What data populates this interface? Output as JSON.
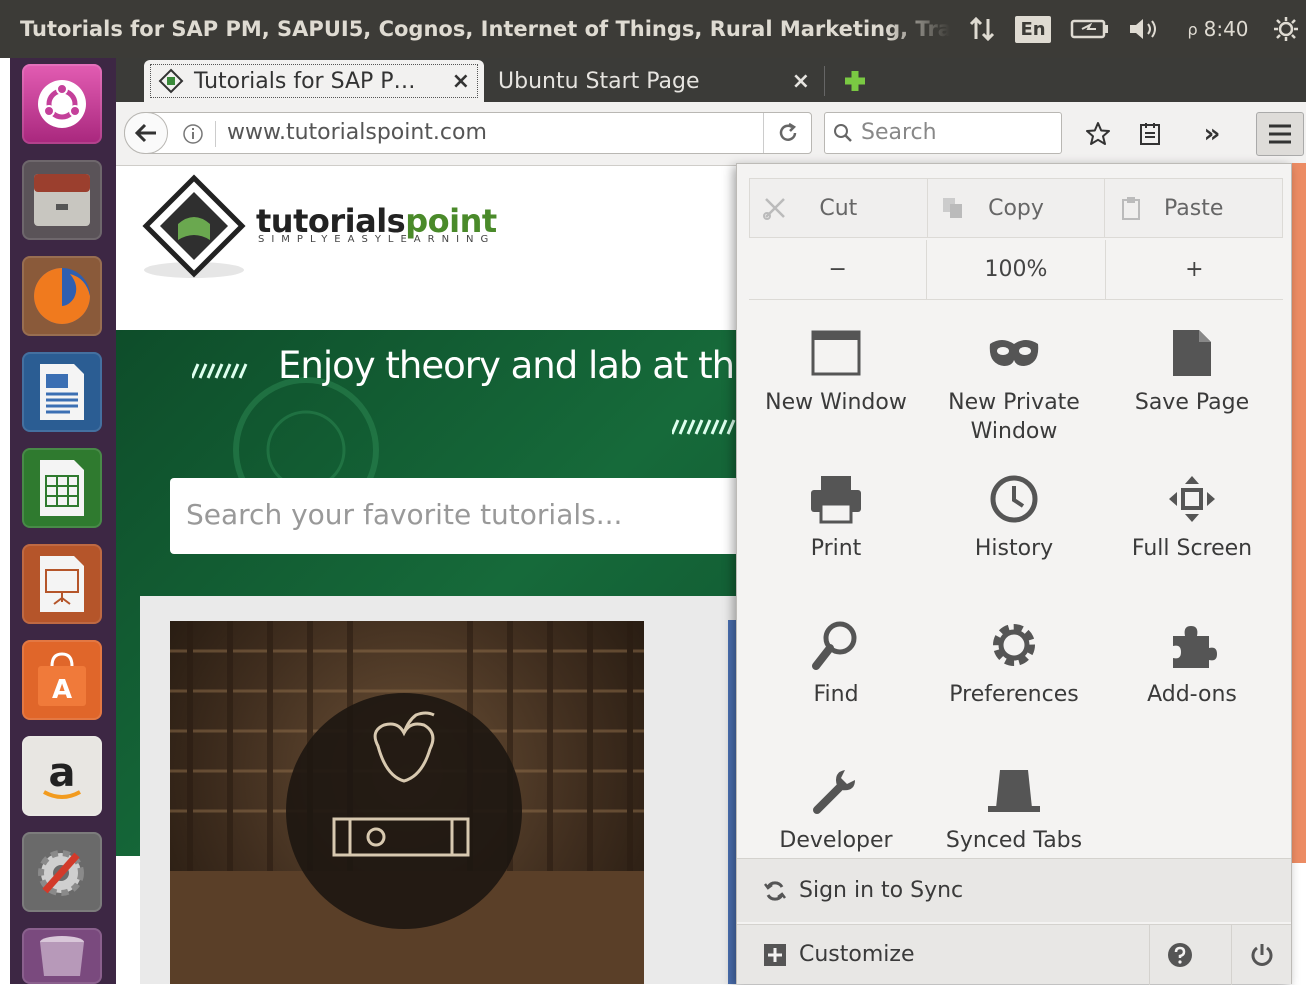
{
  "system_bar": {
    "window_title": "Tutorials for SAP PM, SAPUI5, Cognos, Internet of Things, Rural Marketing, Tra",
    "keyboard_layout": "En",
    "time": "8:40"
  },
  "tabs": [
    {
      "label": "Tutorials for SAP P…",
      "close": "×"
    },
    {
      "label": "Ubuntu Start Page",
      "close": "×"
    }
  ],
  "navbar": {
    "url": "www.tutorialspoint.com",
    "search_placeholder": "Search"
  },
  "page": {
    "logo_text_1": "tutorials",
    "logo_text_2": "point",
    "logo_tagline": "SIMPLYEASYLEARNING",
    "hero_text": "Enjoy theory and lab at the s",
    "search_placeholder": "Search your favorite tutorials..."
  },
  "menu": {
    "edit": {
      "cut": "Cut",
      "copy": "Copy",
      "paste": "Paste"
    },
    "zoom": {
      "minus": "−",
      "level": "100%",
      "plus": "+"
    },
    "items": [
      {
        "label": "New Window",
        "icon": "new-window-icon"
      },
      {
        "label": "New Private Window",
        "icon": "private-mask-icon"
      },
      {
        "label": "Save Page",
        "icon": "save-page-icon"
      },
      {
        "label": "Print",
        "icon": "printer-icon"
      },
      {
        "label": "History",
        "icon": "clock-icon"
      },
      {
        "label": "Full Screen",
        "icon": "full-screen-icon"
      },
      {
        "label": "Find",
        "icon": "magnifier-icon"
      },
      {
        "label": "Preferences",
        "icon": "gear-icon"
      },
      {
        "label": "Add-ons",
        "icon": "puzzle-icon"
      },
      {
        "label": "Developer",
        "icon": "wrench-icon"
      },
      {
        "label": "Synced Tabs",
        "icon": "synced-tabs-icon"
      }
    ],
    "sign_in": "Sign in to Sync",
    "customize": "Customize"
  },
  "colors": {
    "launcher_bg": "#3d2744",
    "panel_bg": "#3c3b37",
    "hero_green": "#166a3a",
    "scroll_accent": "#ec8c64"
  }
}
